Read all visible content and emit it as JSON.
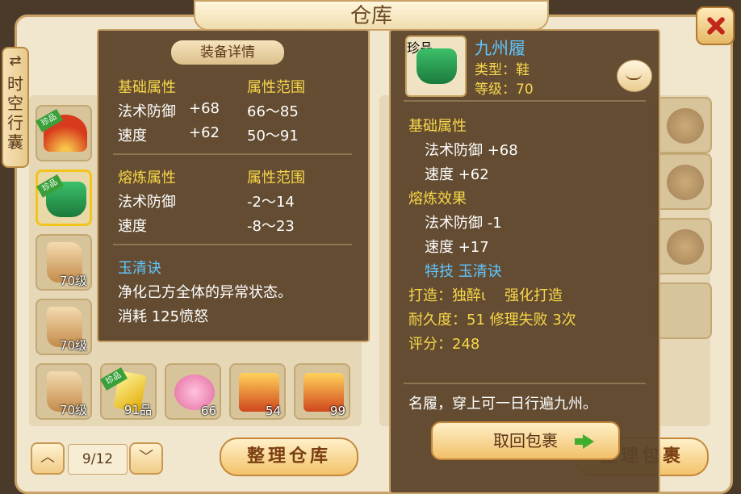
{
  "window": {
    "title": "仓库"
  },
  "side_tab": {
    "label": "时空行囊",
    "icon": "swap-arrows-icon"
  },
  "left_grid": {
    "page_text": "9/12",
    "sort_button": "整理仓库",
    "items": [
      {
        "icon": "fan-icon",
        "count": "",
        "tag": "珍品"
      },
      {
        "icon": "shoe-icon",
        "count": "",
        "tag": "珍品",
        "selected": true
      },
      {
        "icon": "scroll-icon",
        "count": "70级"
      },
      {
        "icon": "scroll-icon",
        "count": "70级"
      },
      {
        "icon": "scroll-icon",
        "count": "70级"
      },
      {
        "icon": "gem-icon",
        "count": "91品",
        "tag": "珍品"
      },
      {
        "icon": "pet-icon",
        "count": "66"
      },
      {
        "icon": "chest-icon",
        "count": "54"
      },
      {
        "icon": "chest-icon",
        "count": "99"
      }
    ]
  },
  "right_panel": {
    "sort_button": "整理包裹"
  },
  "detail_popup": {
    "title": "装备详情",
    "base_header": "基础属性",
    "range_header": "属性范围",
    "base_stats": [
      {
        "name": "法术防御",
        "value": "+68",
        "range": "66～85"
      },
      {
        "name": "速度",
        "value": "+62",
        "range": "50～91"
      }
    ],
    "smelt_header": "熔炼属性",
    "smelt_range_header": "属性范围",
    "smelt_stats": [
      {
        "name": "法术防御",
        "range": "-2～14"
      },
      {
        "name": "速度",
        "range": "-8～23"
      }
    ],
    "skill_name": "玉清诀",
    "skill_desc": "净化己方全体的异常状态。",
    "skill_cost": "消耗 125愤怒"
  },
  "item_popup": {
    "name": "九州履",
    "tag": "珍品",
    "type_line": "类型：鞋",
    "level_line": "等级：70",
    "base_header": "基础属性",
    "base_stats": [
      "法术防御 +68",
      "速度 +62"
    ],
    "smelt_header": "熔炼效果",
    "smelt_stats": [
      "法术防御 -1",
      "速度 +17"
    ],
    "special_line": "特技 玉清诀",
    "craft_line": "打造：独醉ι    强化打造",
    "durability_line": "耐久度：51 修理失败 3次",
    "score_line": "评分：248",
    "description": "名履，穿上可一日行遍九州。",
    "return_button": "取回包裹"
  }
}
